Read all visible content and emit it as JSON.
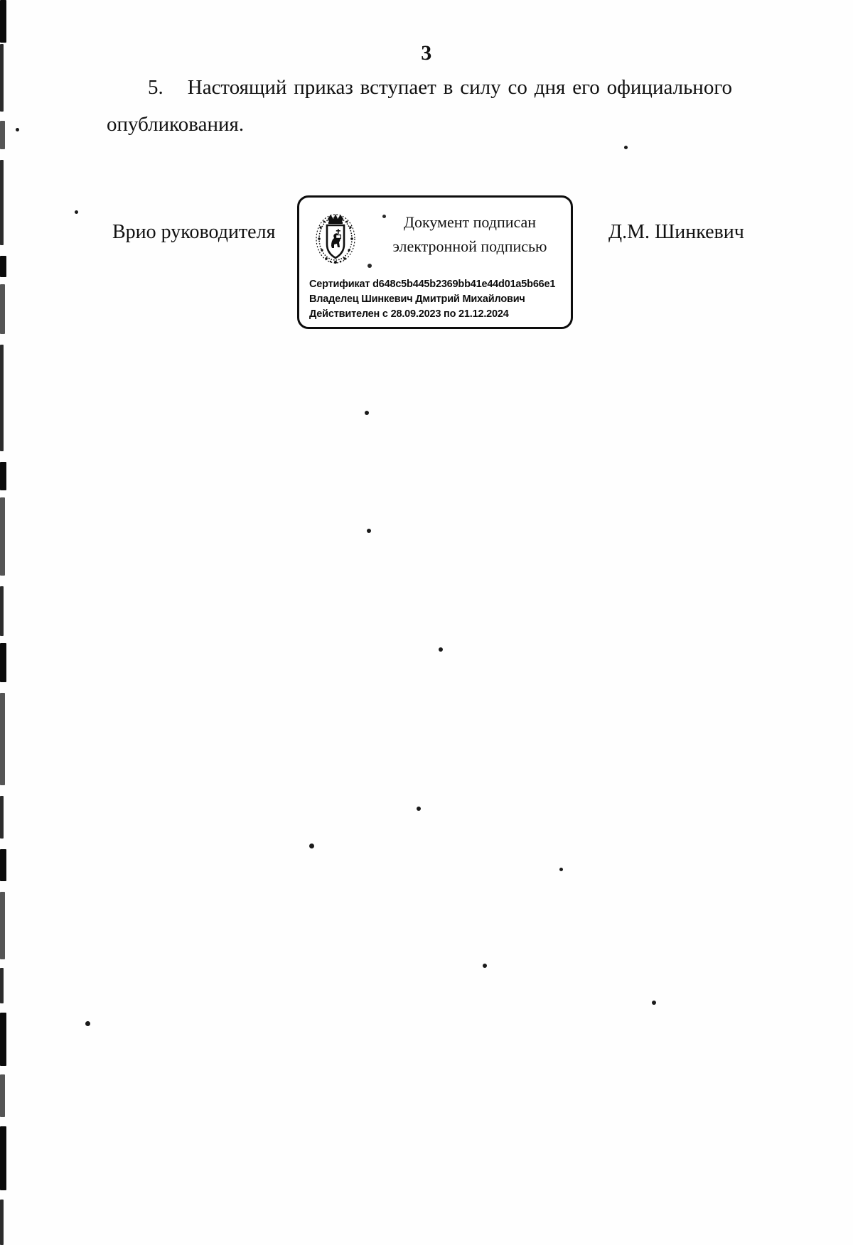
{
  "document": {
    "page_number": "3",
    "paragraph": {
      "number": "5.",
      "text": "Настоящий приказ вступает в силу со дня его официального опубликования."
    },
    "signature_block": {
      "role": "Врио руководителя",
      "signer_name": "Д.М. Шинкевич",
      "esignature_stamp": {
        "emblem": "coat-of-arms-emblem",
        "title_line_1": "Документ подписан",
        "title_line_2": "электронной подписью",
        "certificate_label": "Сертификат",
        "certificate_value": "d648c5b445b2369bb41e44d01a5b66e1",
        "owner_label": "Владелец",
        "owner_value": "Шинкевич Дмитрий Михайлович",
        "validity_label": "Действителен",
        "validity_value": "с 28.09.2023 по 21.12.2024",
        "certificate_line": "Сертификат d648c5b445b2369bb41e44d01a5b66e1",
        "owner_line": "Владелец Шинкевич Дмитрий Михайлович",
        "validity_line": "Действителен с 28.09.2023 по 21.12.2024"
      }
    }
  },
  "colors": {
    "ink": "#111111",
    "paper": "#ffffff",
    "stamp_border": "#0d0d0d"
  }
}
